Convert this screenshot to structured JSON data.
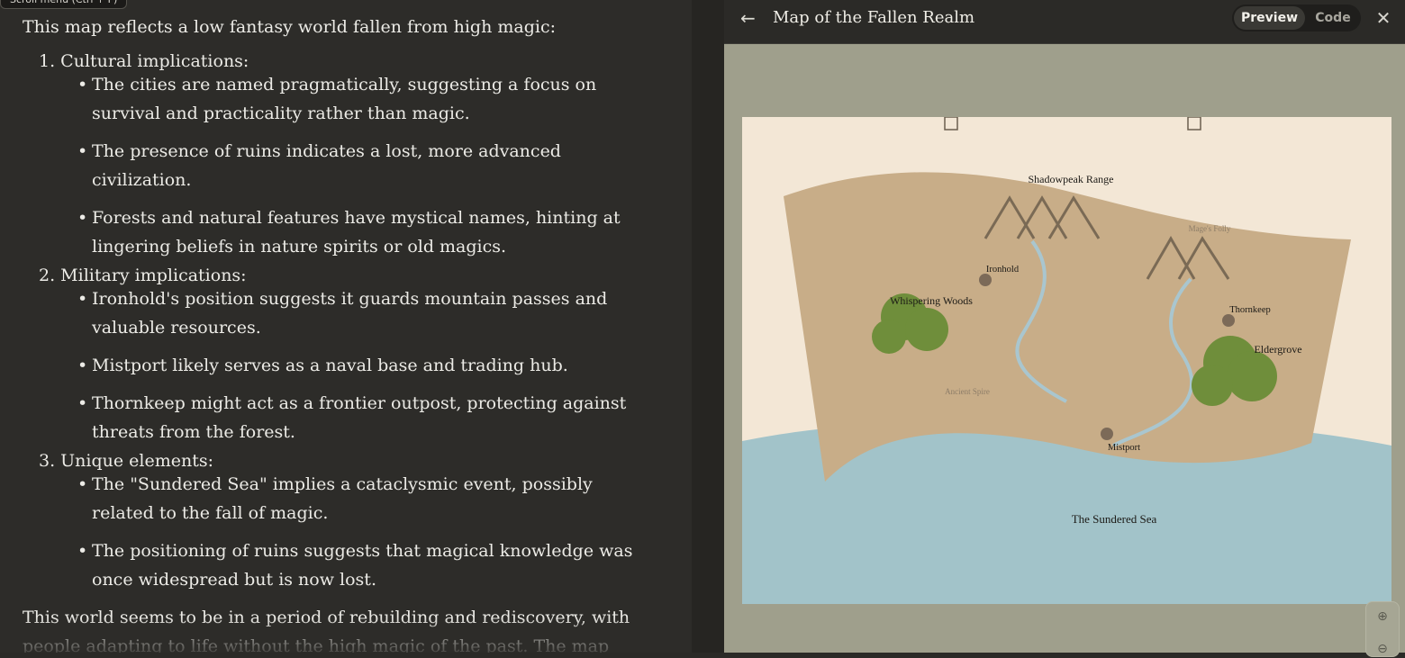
{
  "chat": {
    "tooltip": "Scroll menu (Ctrl + F)",
    "intro": "This map reflects a low fantasy world fallen from high magic:",
    "sections": [
      {
        "title": "1. Cultural implications:",
        "items": [
          "The cities are named pragmatically, suggesting a focus on survival and practicality rather than magic.",
          "The presence of ruins indicates a lost, more advanced civilization.",
          "Forests and natural features have mystical names, hinting at lingering beliefs in nature spirits or old magics."
        ]
      },
      {
        "title": "2. Military implications:",
        "items": [
          "Ironhold's position suggests it guards mountain passes and valuable resources.",
          "Mistport likely serves as a naval base and trading hub.",
          "Thornkeep might act as a frontier outpost, protecting against threats from the forest."
        ]
      },
      {
        "title": "3. Unique elements:",
        "items": [
          "The \"Sundered Sea\" implies a cataclysmic event, possibly related to the fall of magic.",
          "The positioning of ruins suggests that magical knowledge was once widespread but is now lost."
        ]
      }
    ],
    "outro": "This world seems to be in a period of rebuilding and rediscovery, with people adapting to life without the high magic of the past. The map hints at potential"
  },
  "artifact": {
    "title": "Map of the Fallen Realm",
    "toggle": {
      "preview": "Preview",
      "code": "Code"
    },
    "map": {
      "labels": {
        "range": "Shadowpeak Range",
        "mages_folly": "Mage's Folly",
        "ironhold": "Ironhold",
        "whispering_woods": "Whispering Woods",
        "thornkeep": "Thornkeep",
        "eldergrove": "Eldergrove",
        "ancient_spire": "Ancient Spire",
        "mistport": "Mistport",
        "sea": "The Sundered Sea"
      },
      "colors": {
        "parchment": "#f3e7d6",
        "land": "#c8ad88",
        "forest": "#6f8e3b",
        "sea": "#a2c3c9",
        "river": "#a9c6cf",
        "mountain": "#7a6a55",
        "city": "#7c6a58"
      }
    }
  }
}
